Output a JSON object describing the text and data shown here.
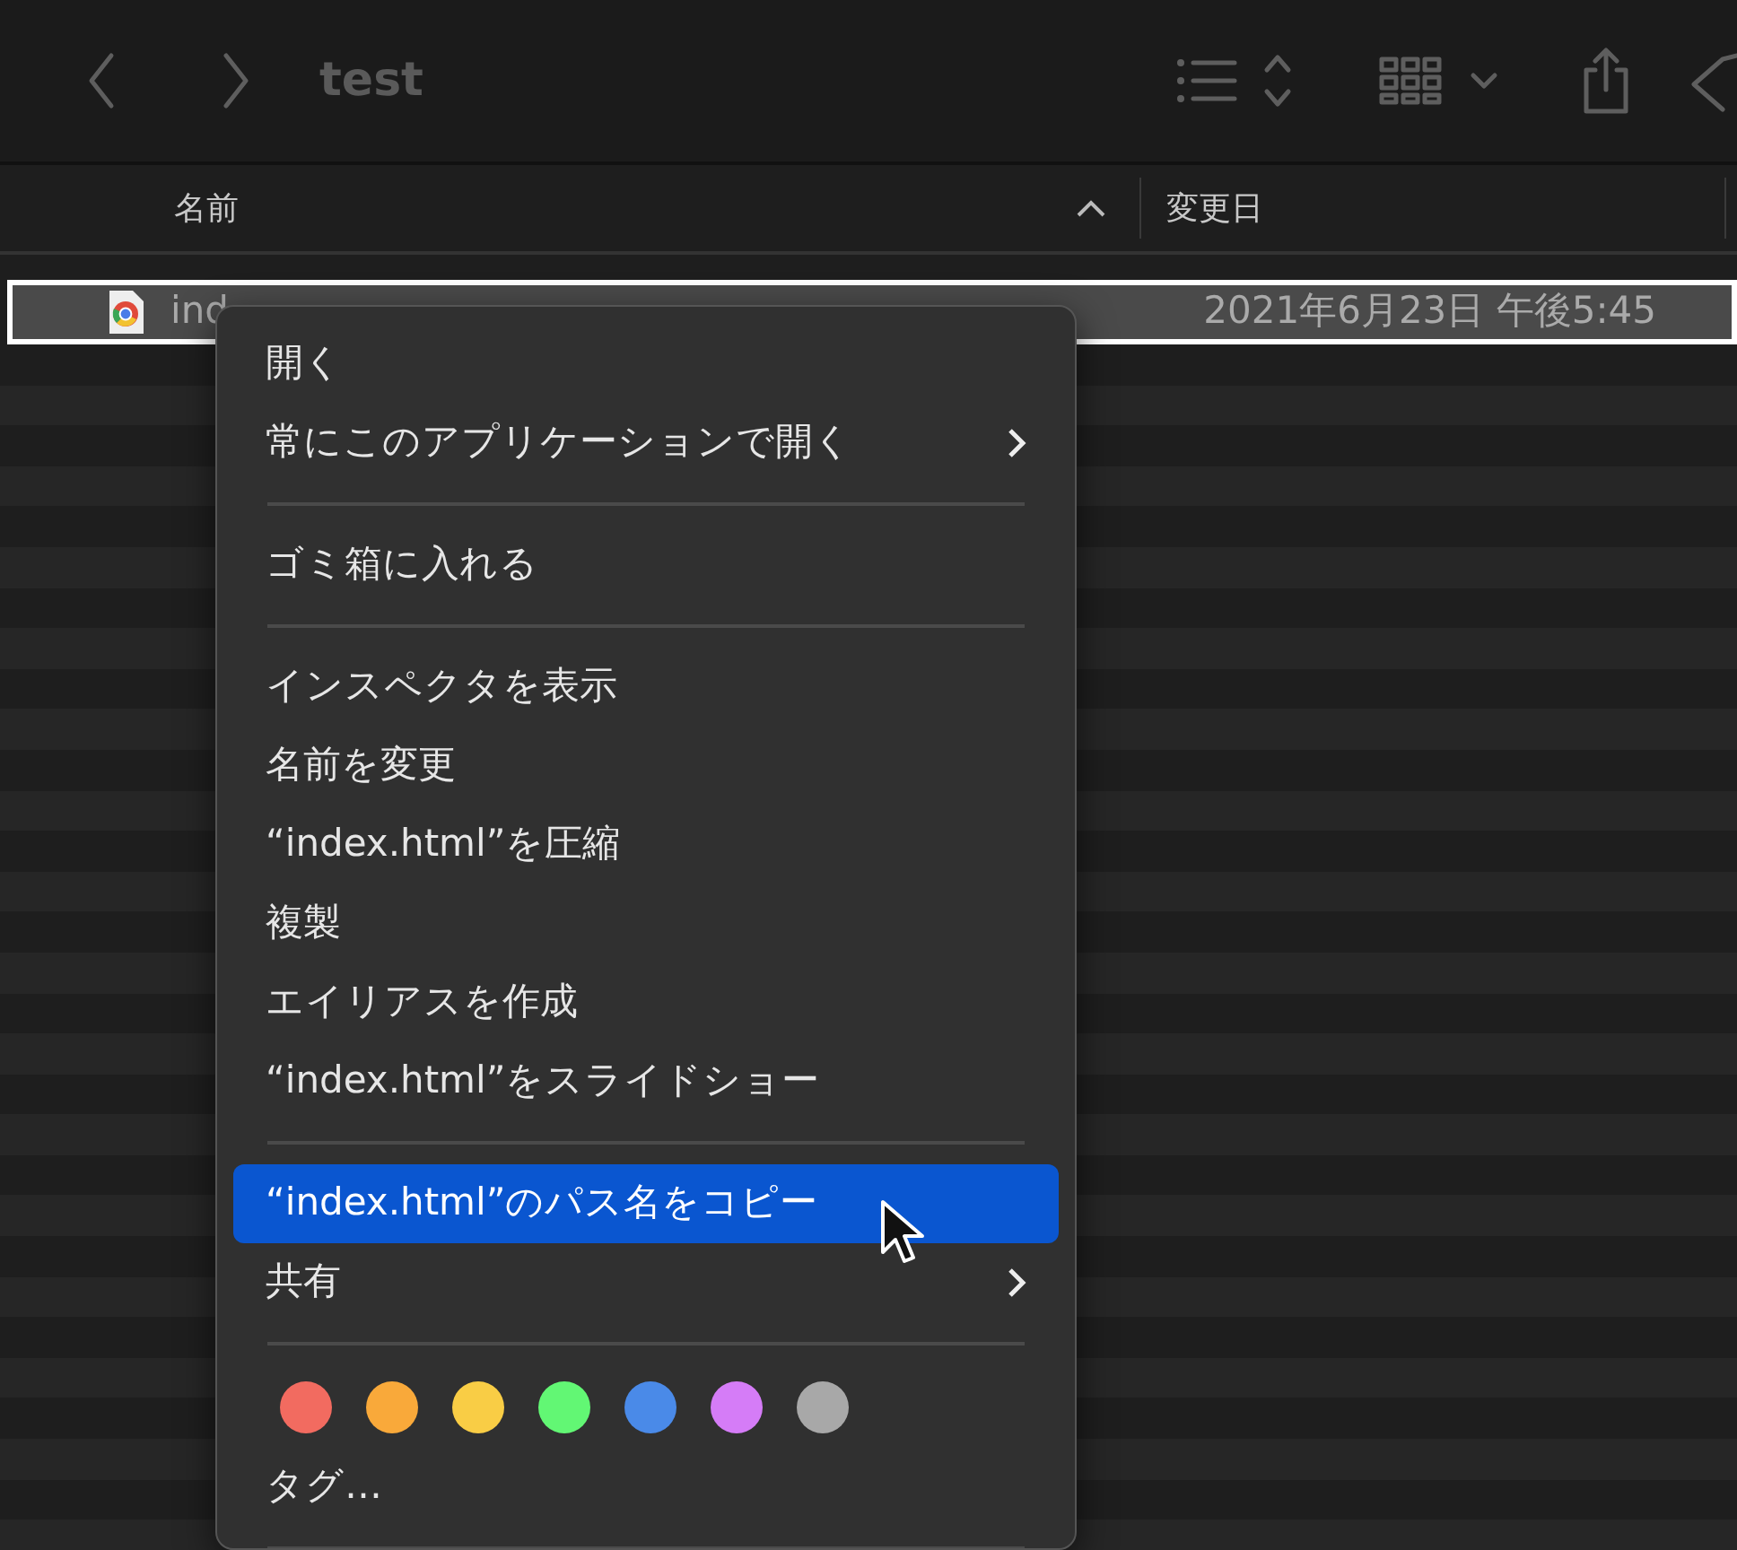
{
  "window": {
    "title": "test"
  },
  "columns": [
    {
      "label": "名前",
      "sorted": true
    },
    {
      "label": "変更日",
      "sorted": false
    }
  ],
  "files": [
    {
      "name": "ind",
      "modified": "2021年6月23日 午後5:45",
      "selected": true
    }
  ],
  "context_menu": {
    "items": [
      {
        "kind": "item",
        "label": "開く",
        "submenu": false,
        "selected": false
      },
      {
        "kind": "item",
        "label": "常にこのアプリケーションで開く",
        "submenu": true,
        "selected": false
      },
      {
        "kind": "separator"
      },
      {
        "kind": "item",
        "label": "ゴミ箱に入れる",
        "submenu": false,
        "selected": false
      },
      {
        "kind": "separator"
      },
      {
        "kind": "item",
        "label": "インスペクタを表示",
        "submenu": false,
        "selected": false
      },
      {
        "kind": "item",
        "label": "名前を変更",
        "submenu": false,
        "selected": false
      },
      {
        "kind": "item",
        "label": "“index.html”を圧縮",
        "submenu": false,
        "selected": false
      },
      {
        "kind": "item",
        "label": "複製",
        "submenu": false,
        "selected": false
      },
      {
        "kind": "item",
        "label": "エイリアスを作成",
        "submenu": false,
        "selected": false
      },
      {
        "kind": "item",
        "label": "“index.html”をスライドショー",
        "submenu": false,
        "selected": false
      },
      {
        "kind": "separator"
      },
      {
        "kind": "item",
        "label": "“index.html”のパス名をコピー",
        "submenu": false,
        "selected": true
      },
      {
        "kind": "item",
        "label": "共有",
        "submenu": true,
        "selected": false
      },
      {
        "kind": "separator"
      },
      {
        "kind": "tags",
        "dots": [
          {
            "color": "#f26b60"
          },
          {
            "color": "#f9a93a"
          },
          {
            "color": "#f9cd45"
          },
          {
            "color": "#62f774"
          },
          {
            "color": "#4a8ae8"
          },
          {
            "color": "#d57cf7"
          },
          {
            "color": "#a8a8a8"
          }
        ]
      },
      {
        "kind": "item",
        "label": "タグ…",
        "submenu": false,
        "selected": false
      },
      {
        "kind": "separator"
      }
    ]
  }
}
